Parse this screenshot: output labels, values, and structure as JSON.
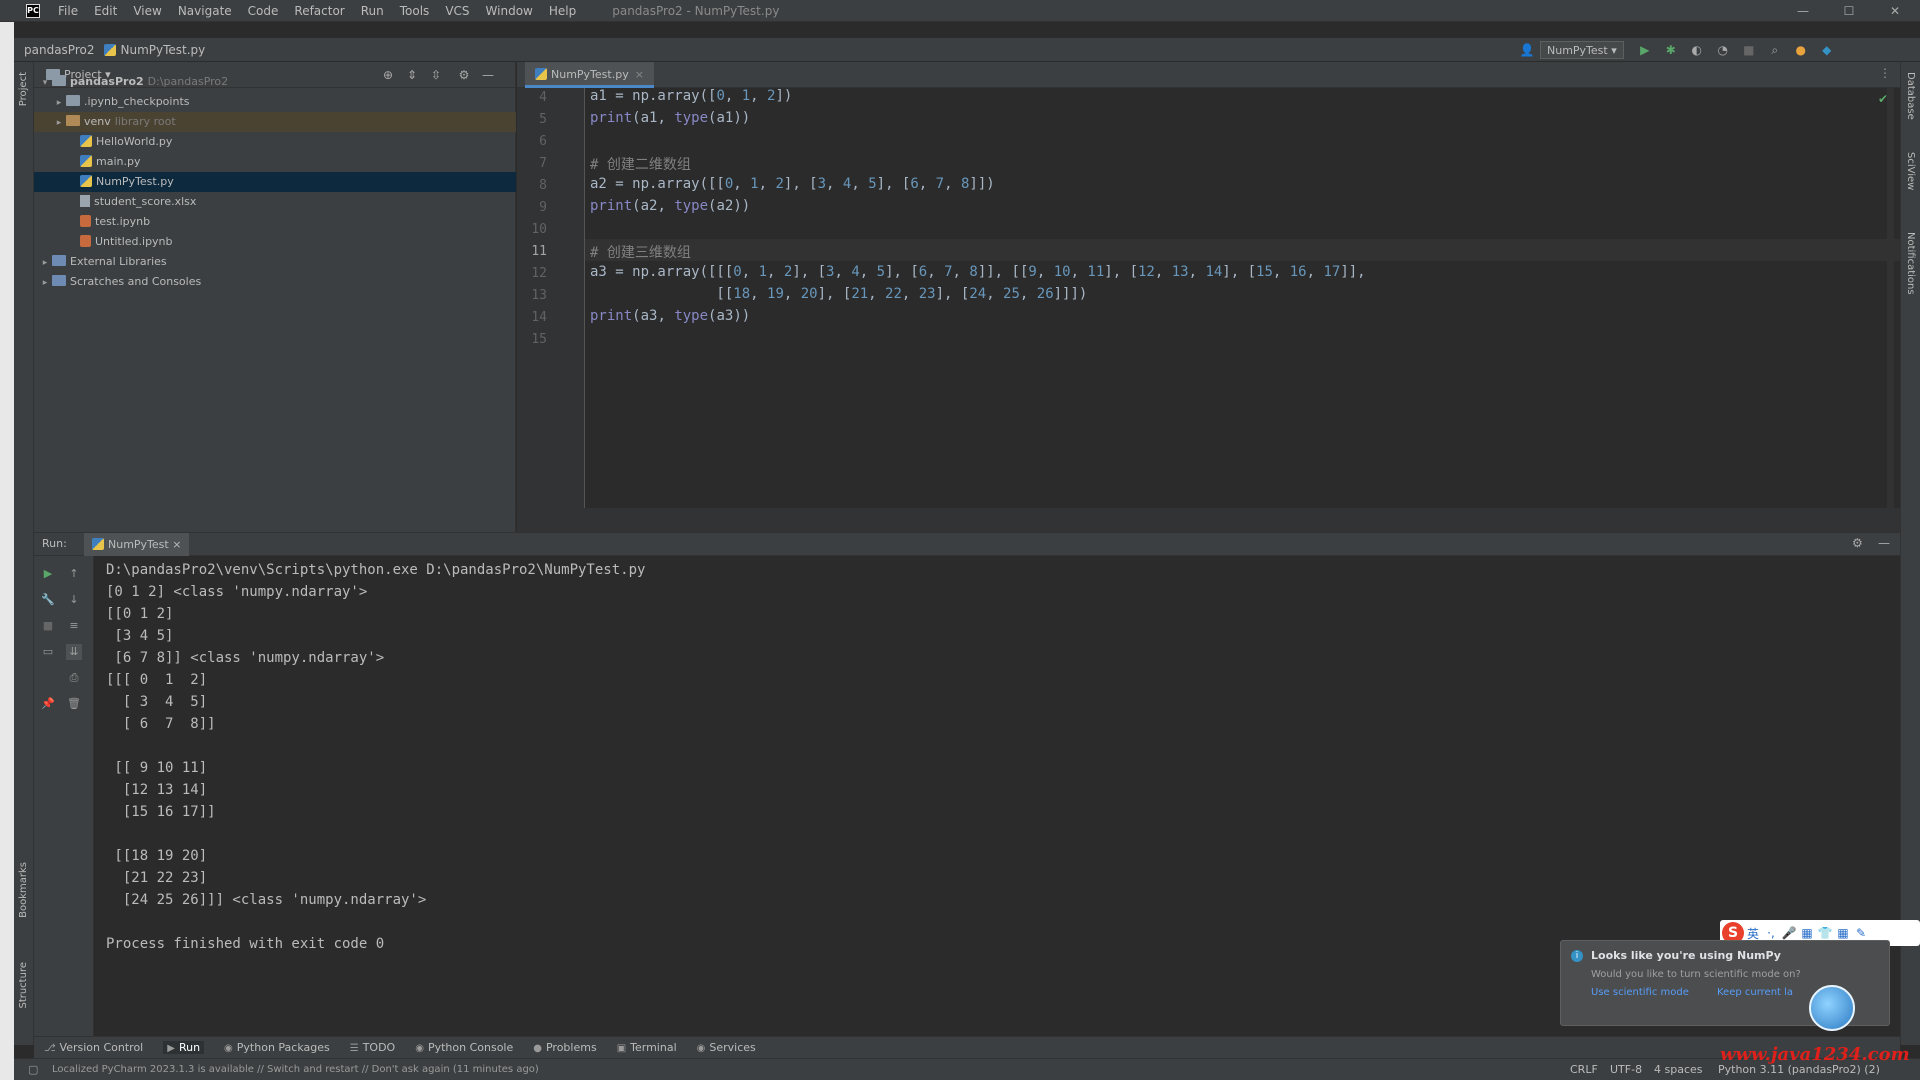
{
  "window": {
    "logo": "PC",
    "menu": [
      "File",
      "Edit",
      "View",
      "Navigate",
      "Code",
      "Refactor",
      "Run",
      "Tools",
      "VCS",
      "Window",
      "Help"
    ],
    "title": "pandasPro2 - NumPyTest.py",
    "controls": [
      "—",
      "☐",
      "✕"
    ]
  },
  "navbar": {
    "project": "pandasPro2",
    "file": "NumPyTest.py",
    "run_config": "NumPyTest ▾"
  },
  "left_stripe": {
    "project": "Project",
    "bookmarks": "Bookmarks",
    "structure": "Structure"
  },
  "right_stripe": {
    "database": "Database",
    "sciview": "SciView",
    "notifications": "Notifications"
  },
  "project_panel": {
    "title": "Project ▾",
    "tree": [
      {
        "arrow": "▾",
        "label": "pandasPro2",
        "muted": "D:\\pandasPro2",
        "icon": "folder"
      },
      {
        "arrow": "▸",
        "label": ".ipynb_checkpoints",
        "muted": "",
        "icon": "folder"
      },
      {
        "arrow": "▸",
        "label": "venv",
        "muted": "library root",
        "icon": "folder-excluded"
      },
      {
        "arrow": "",
        "label": "HelloWorld.py",
        "muted": "",
        "icon": "py"
      },
      {
        "arrow": "",
        "label": "main.py",
        "muted": "",
        "icon": "py"
      },
      {
        "arrow": "",
        "label": "NumPyTest.py",
        "muted": "",
        "icon": "py"
      },
      {
        "arrow": "",
        "label": "student_score.xlsx",
        "muted": "",
        "icon": "txt"
      },
      {
        "arrow": "",
        "label": "test.ipynb",
        "muted": "",
        "icon": "nb"
      },
      {
        "arrow": "",
        "label": "Untitled.ipynb",
        "muted": "",
        "icon": "nb"
      },
      {
        "arrow": "▸",
        "label": "External Libraries",
        "muted": "",
        "icon": "lib"
      },
      {
        "arrow": "▸",
        "label": "Scratches and Consoles",
        "muted": "",
        "icon": "lib"
      }
    ]
  },
  "editor": {
    "tab": "NumPyTest.py",
    "lines": [
      {
        "n": "4",
        "text": "a1 = np.array([0, 1, 2])"
      },
      {
        "n": "5",
        "text": "print(a1, type(a1))"
      },
      {
        "n": "6",
        "text": ""
      },
      {
        "n": "7",
        "text": "# 创建二维数组"
      },
      {
        "n": "8",
        "text": "a2 = np.array([[0, 1, 2], [3, 4, 5], [6, 7, 8]])"
      },
      {
        "n": "9",
        "text": "print(a2, type(a2))"
      },
      {
        "n": "10",
        "text": ""
      },
      {
        "n": "11",
        "text": "# 创建三维数组"
      },
      {
        "n": "12",
        "text": "a3 = np.array([[[0, 1, 2], [3, 4, 5], [6, 7, 8]], [[9, 10, 11], [12, 13, 14], [15, 16, 17]],"
      },
      {
        "n": "13",
        "text": "               [[18, 19, 20], [21, 22, 23], [24, 25, 26]]])"
      },
      {
        "n": "14",
        "text": "print(a3, type(a3))"
      },
      {
        "n": "15",
        "text": ""
      }
    ],
    "current_line": "11"
  },
  "run_panel": {
    "label": "Run:",
    "tab": "NumPyTest ×",
    "output": [
      "D:\\pandasPro2\\venv\\Scripts\\python.exe D:\\pandasPro2\\NumPyTest.py",
      "[0 1 2] <class 'numpy.ndarray'>",
      "[[0 1 2]",
      " [3 4 5]",
      " [6 7 8]] <class 'numpy.ndarray'>",
      "[[[ 0  1  2]",
      "  [ 3  4  5]",
      "  [ 6  7  8]]",
      "",
      " [[ 9 10 11]",
      "  [12 13 14]",
      "  [15 16 17]]",
      "",
      " [[18 19 20]",
      "  [21 22 23]",
      "  [24 25 26]]] <class 'numpy.ndarray'>",
      "",
      "Process finished with exit code 0"
    ]
  },
  "notification": {
    "title": "Looks like you're using NumPy",
    "body": "Would you like to turn scientific mode on?",
    "action_primary": "Use scientific mode",
    "action_secondary": "Keep current la"
  },
  "ime": {
    "logo": "S",
    "cells": [
      "英",
      "·,",
      "🎤",
      "▦",
      "👕",
      "▦",
      "✎"
    ]
  },
  "bottom_tools": [
    {
      "glyph": "⎇",
      "label": "Version Control"
    },
    {
      "glyph": "▶",
      "label": "Run"
    },
    {
      "glyph": "◉",
      "label": "Python Packages"
    },
    {
      "glyph": "☰",
      "label": "TODO"
    },
    {
      "glyph": "◉",
      "label": "Python Console"
    },
    {
      "glyph": "●",
      "label": "Problems"
    },
    {
      "glyph": "▣",
      "label": "Terminal"
    },
    {
      "glyph": "◉",
      "label": "Services"
    }
  ],
  "statusbar": {
    "message": "Localized PyCharm 2023.1.3 is available // Switch and restart // Don't ask again (11 minutes ago)",
    "line_sep": "CRLF",
    "encoding": "UTF-8",
    "indent": "4 spaces",
    "interpreter": "Python 3.11 (pandasPro2) (2)"
  },
  "watermark": "www.java1234.com",
  "colors": {
    "keyword": "#8888c6",
    "number": "#6897bb",
    "comment": "#808080",
    "accent": "#4a88c7"
  }
}
